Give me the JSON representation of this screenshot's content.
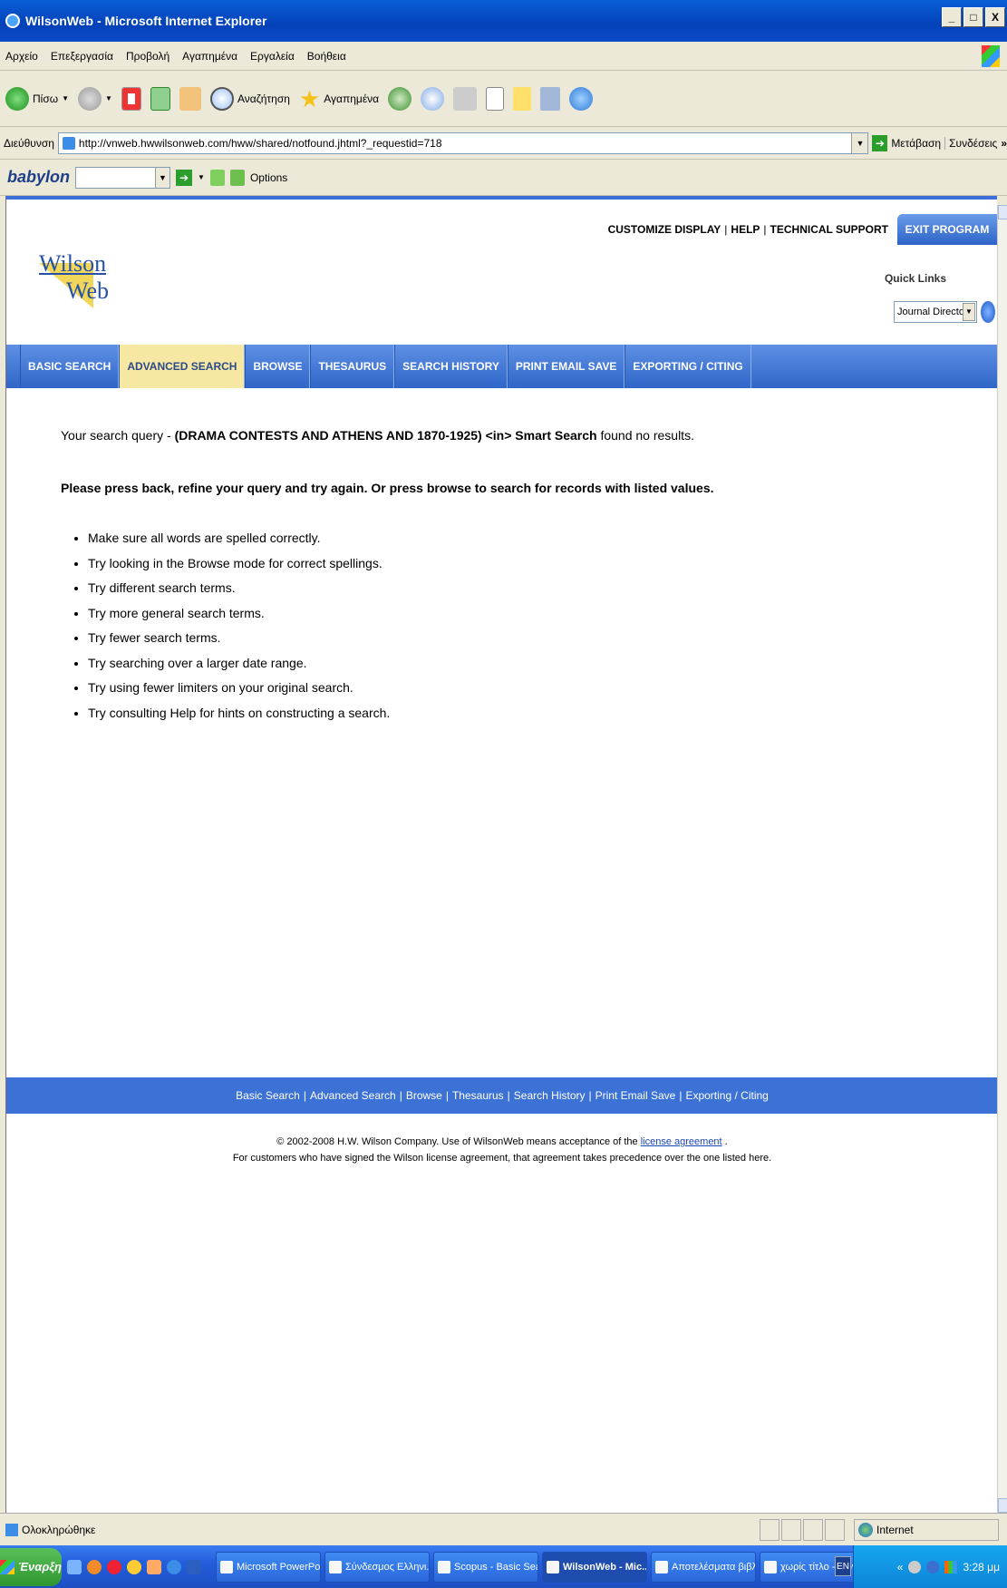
{
  "window": {
    "title": "WilsonWeb - Microsoft Internet Explorer",
    "controls": [
      "_",
      "□",
      "X"
    ]
  },
  "menu": [
    "Αρχείο",
    "Επεξεργασία",
    "Προβολή",
    "Αγαπημένα",
    "Εργαλεία",
    "Βοήθεια"
  ],
  "toolbar": {
    "back_label": "Πίσω",
    "search_label": "Αναζήτηση",
    "favorites_label": "Αγαπημένα"
  },
  "address": {
    "label": "Διεύθυνση",
    "url": "http://vnweb.hwwilsonweb.com/hww/shared/notfound.jhtml?_requestid=718",
    "go_label": "Μετάβαση",
    "links_label": "Συνδέσεις",
    "more": "»"
  },
  "babylon": {
    "logo": "babylon",
    "options_label": "Options"
  },
  "header": {
    "links": [
      "CUSTOMIZE DISPLAY",
      "HELP",
      "TECHNICAL SUPPORT"
    ],
    "exit": "EXIT PROGRAM",
    "logo_line1": "Wilson",
    "logo_line2": "Web",
    "quick_links_label": "Quick Links",
    "quick_links_selected": "Journal Directory"
  },
  "nav": [
    {
      "label": "BASIC SEARCH",
      "active": false
    },
    {
      "label": "ADVANCED SEARCH",
      "active": true
    },
    {
      "label": "BROWSE",
      "active": false
    },
    {
      "label": "THESAURUS",
      "active": false
    },
    {
      "label": "SEARCH HISTORY",
      "active": false
    },
    {
      "label": "PRINT EMAIL SAVE",
      "active": false
    },
    {
      "label": "EXPORTING / CITING",
      "active": false
    }
  ],
  "result": {
    "prefix": "Your search query - ",
    "query": "(DRAMA CONTESTS AND ATHENS AND 1870-1925) <in> Smart Search",
    "suffix": " found no results.",
    "instructions": "Please press back, refine your query and try again. Or press browse to search for records with listed values.",
    "tips": [
      "Make sure all words are spelled correctly.",
      "Try looking in the Browse mode for correct spellings.",
      "Try different search terms.",
      "Try more general search terms.",
      "Try fewer search terms.",
      "Try searching over a larger date range.",
      "Try using fewer limiters on your original search.",
      "Try consulting Help for hints on constructing a search."
    ]
  },
  "footer": {
    "links": [
      "Basic Search",
      "Advanced Search",
      "Browse",
      "Thesaurus",
      "Search History",
      "Print Email Save",
      "Exporting / Citing"
    ],
    "copyright_prefix": "© 2002-2008 H.W. Wilson Company. Use of WilsonWeb means acceptance of the ",
    "license_link": "license agreement",
    "copyright_suffix": " .",
    "note": "For customers who have signed the Wilson license agreement, that agreement takes precedence over the one listed here."
  },
  "status": {
    "text": "Ολοκληρώθηκε",
    "zone": "Internet"
  },
  "taskbar": {
    "start": "Έναρξη",
    "tasks": [
      {
        "label": "Microsoft PowerPoi...",
        "active": false
      },
      {
        "label": "Σύνδεσμος Ελληνι...",
        "active": false
      },
      {
        "label": "Scopus - Basic Sea...",
        "active": false
      },
      {
        "label": "WilsonWeb - Mic...",
        "active": true
      },
      {
        "label": "Αποτελέσματα βιβλ...",
        "active": false
      },
      {
        "label": "χωρίς τίτλο - Ζωγρ...",
        "active": false
      }
    ],
    "lang": "EN",
    "tray_more": "«",
    "clock": "3:28 μμ"
  },
  "colors": {
    "nav_blue": "#2f66c8",
    "nav_active": "#f6e7a2",
    "footer_blue": "#3c72d6",
    "link": "#1b46b6"
  }
}
